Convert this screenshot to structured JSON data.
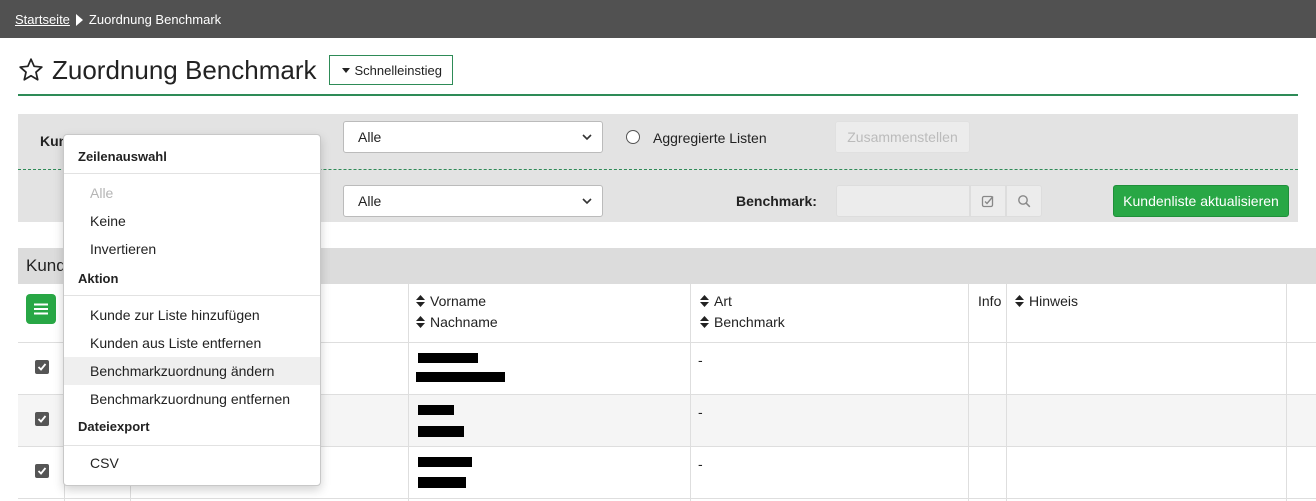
{
  "breadcrumb": {
    "home": "Startseite",
    "current": "Zuordnung Benchmark"
  },
  "page": {
    "title": "Zuordnung Benchmark",
    "quick_access": "Schnelleinstieg"
  },
  "filter": {
    "customer_list_label": "Kun",
    "list_select_value": "Alle",
    "aggregated_lists_label": "Aggregierte Listen",
    "assemble_button": "Zusammenstellen",
    "second_select_value": "Alle",
    "benchmark_label": "Benchmark:",
    "update_button": "Kundenliste aktualisieren"
  },
  "table": {
    "section_title": "Kund",
    "columns": {
      "firstname": "Vorname",
      "lastname": "Nachname",
      "type": "Art",
      "benchmark": "Benchmark",
      "info": "Info",
      "note": "Hinweis"
    },
    "rows": [
      {
        "checked": true,
        "art": "-"
      },
      {
        "checked": true,
        "art": "-"
      },
      {
        "checked": true,
        "art": "-"
      }
    ]
  },
  "menu": {
    "sections": {
      "selection": "Zeilenauswahl",
      "action": "Aktion",
      "export": "Dateiexport"
    },
    "items": {
      "all": "Alle",
      "none": "Keine",
      "invert": "Invertieren",
      "add_customer": "Kunde zur Liste hinzufügen",
      "remove_customers": "Kunden aus Liste entfernen",
      "change_benchmark": "Benchmarkzuordnung ändern",
      "remove_benchmark": "Benchmarkzuordnung entfernen",
      "csv": "CSV"
    }
  },
  "colors": {
    "accent": "#2e8b57",
    "button_green": "#28a745",
    "topbar": "#515151"
  }
}
